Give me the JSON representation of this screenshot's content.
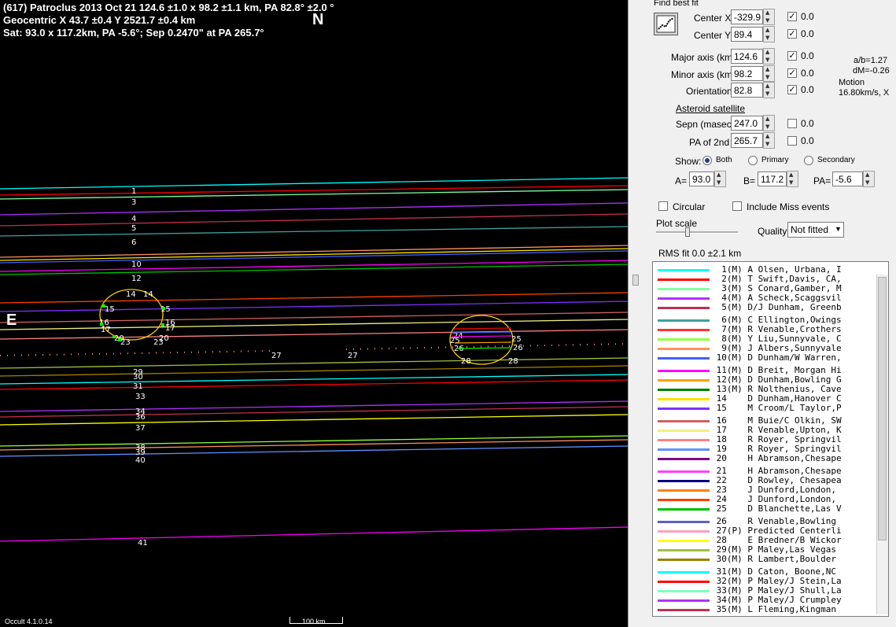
{
  "plot": {
    "header_line1": "(617) Patroclus  2013 Oct 21   124.6 ±1.0 x 98.2 ±1.1 km, PA 82.8° ±2.0 °",
    "header_line2": "Geocentric  X  43.7 ±0.4  Y 2521.7 ±0.4 km",
    "header_line3": "Sat: 93.0 x 117.2km, PA -5.6°; Sep 0.2470\" at PA 265.7°",
    "north": "N",
    "east": "E",
    "version": "Occult 4.1.0.14",
    "scale_label": "100 km.",
    "chord_labels": [
      "1",
      "3",
      "4",
      "5",
      "6",
      "10",
      "12",
      "14",
      "14",
      "15",
      "15",
      "16",
      "16",
      "17",
      "17",
      "20",
      "20",
      "23",
      "23",
      "24",
      "25",
      "26",
      "26",
      "28",
      "28",
      "27",
      "27",
      "29",
      "30",
      "31",
      "33",
      "34",
      "36",
      "37",
      "38",
      "39",
      "40",
      "41"
    ]
  },
  "panel": {
    "find_best_fit": "Find best fit",
    "center_x_label": "Center X",
    "center_x_value": "-329.9",
    "center_y_label": "Center Y",
    "center_y_value": "89.4",
    "major_axis_label": "Major axis (km)",
    "major_axis_value": "124.6",
    "minor_axis_label": "Minor axis (km)",
    "minor_axis_value": "98.2",
    "orientation_label": "Orientation",
    "orientation_value": "82.8",
    "fit_zero": "0.0",
    "ab_ratio": "a/b=1.27",
    "dm": "dM=-0.26",
    "motion_label": "Motion",
    "motion_value": "16.80km/s, X",
    "asteroid_satellite": "Asteroid satellite",
    "sepn_label": "Sepn (masec)",
    "sepn_value": "247.0",
    "pa2nd_label": "PA of 2nd",
    "pa2nd_value": "265.7",
    "show_label": "Show:",
    "show_both": "Both",
    "show_primary": "Primary",
    "show_secondary": "Secondary",
    "a_label": "A=",
    "a_value": "93.0",
    "b_label": "B=",
    "b_value": "117.2",
    "pa_label": "PA=",
    "pa_value": "-5.6",
    "circular": "Circular",
    "include_miss": "Include Miss events",
    "plot_scale": "Plot scale",
    "quality_label": "Quality",
    "quality_value": "Not fitted",
    "rms_fit": "RMS fit 0.0 ±2.1 km"
  },
  "observers": [
    {
      "num": "1",
      "flag": "(M)",
      "name": "A Olsen, Urbana, I",
      "color": "#00ffff"
    },
    {
      "num": "2",
      "flag": "(M)",
      "name": "T Swift,Davis, CA,",
      "color": "#ff0000"
    },
    {
      "num": "3",
      "flag": "(M)",
      "name": "S Conard,Gamber, M",
      "color": "#80ffa0"
    },
    {
      "num": "4",
      "flag": "(M)",
      "name": "A Scheck,Scaggsvil",
      "color": "#b030ff"
    },
    {
      "num": "5",
      "flag": "(M)",
      "name": "D/J Dunham, Greenb",
      "color": "#c03050"
    },
    {
      "num": "6",
      "flag": "(M)",
      "name": "C Ellington,Owings",
      "color": "#40a0a0"
    },
    {
      "num": "7",
      "flag": "(M)",
      "name": "R Venable,Crothers",
      "color": "#ff3030"
    },
    {
      "num": "8",
      "flag": "(M)",
      "name": "Y Liu,Sunnyvale, C",
      "color": "#90ff40"
    },
    {
      "num": "9",
      "flag": "(M)",
      "name": "J Albers,Sunnyvale",
      "color": "#ff9060"
    },
    {
      "num": "10",
      "flag": "(M)",
      "name": "D Dunham/W Warren,",
      "color": "#4060ff"
    },
    {
      "num": "11",
      "flag": "(M)",
      "name": "D Breit, Morgan Hi",
      "color": "#ff00ff"
    },
    {
      "num": "12",
      "flag": "(M)",
      "name": "D Dunham,Bowling G",
      "color": "#ffa000"
    },
    {
      "num": "13",
      "flag": "(M)",
      "name": "R Nolthenius, Cave",
      "color": "#008000"
    },
    {
      "num": "14",
      "flag": "",
      "name": "D Dunham,Hanover C",
      "color": "#ffe000"
    },
    {
      "num": "15",
      "flag": "",
      "name": "M Croom/L Taylor,P",
      "color": "#8030ff"
    },
    {
      "num": "16",
      "flag": "",
      "name": "M Buie/C Olkin, SW",
      "color": "#d06060"
    },
    {
      "num": "17",
      "flag": "",
      "name": "R Venable,Upton, K",
      "color": "#f0f080"
    },
    {
      "num": "18",
      "flag": "",
      "name": "R Royer, Springvil",
      "color": "#ff8080"
    },
    {
      "num": "19",
      "flag": "",
      "name": "R Royer, Springvil",
      "color": "#6090ff"
    },
    {
      "num": "20",
      "flag": "",
      "name": "H Abramson,Chesape",
      "color": "#800080"
    },
    {
      "num": "21",
      "flag": "",
      "name": "H Abramson,Chesape",
      "color": "#ff40ff"
    },
    {
      "num": "22",
      "flag": "",
      "name": "D Rowley, Chesapea",
      "color": "#000080"
    },
    {
      "num": "23",
      "flag": "",
      "name": "J Dunford,London,",
      "color": "#ff8000"
    },
    {
      "num": "24",
      "flag": "",
      "name": "J Dunford,London,",
      "color": "#ff4000"
    },
    {
      "num": "25",
      "flag": "",
      "name": "D Blanchette,Las V",
      "color": "#00c000"
    },
    {
      "num": "26",
      "flag": "",
      "name": "R Venable,Bowling",
      "color": "#6060c0"
    },
    {
      "num": "27",
      "flag": "(P)",
      "name": "Predicted Centerli",
      "color": "#ffa0c0"
    },
    {
      "num": "28",
      "flag": "",
      "name": "E Bredner/B Wickor",
      "color": "#ffff00"
    },
    {
      "num": "29",
      "flag": "(M)",
      "name": "P Maley,Las Vegas",
      "color": "#a0c040"
    },
    {
      "num": "30",
      "flag": "(M)",
      "name": "R Lambert,Boulder",
      "color": "#a08000"
    },
    {
      "num": "31",
      "flag": "(M)",
      "name": "D Caton, Boone,NC",
      "color": "#00ffff"
    },
    {
      "num": "32",
      "flag": "(M)",
      "name": "P Maley/J Stein,La",
      "color": "#ff0000"
    },
    {
      "num": "33",
      "flag": "(M)",
      "name": "P Maley/J Shull,La",
      "color": "#80ffc0"
    },
    {
      "num": "34",
      "flag": "(M)",
      "name": "P Maley/J Crumpley",
      "color": "#b030ff"
    },
    {
      "num": "35",
      "flag": "(M)",
      "name": "L Fleming,Kingman",
      "color": "#c03050"
    }
  ]
}
